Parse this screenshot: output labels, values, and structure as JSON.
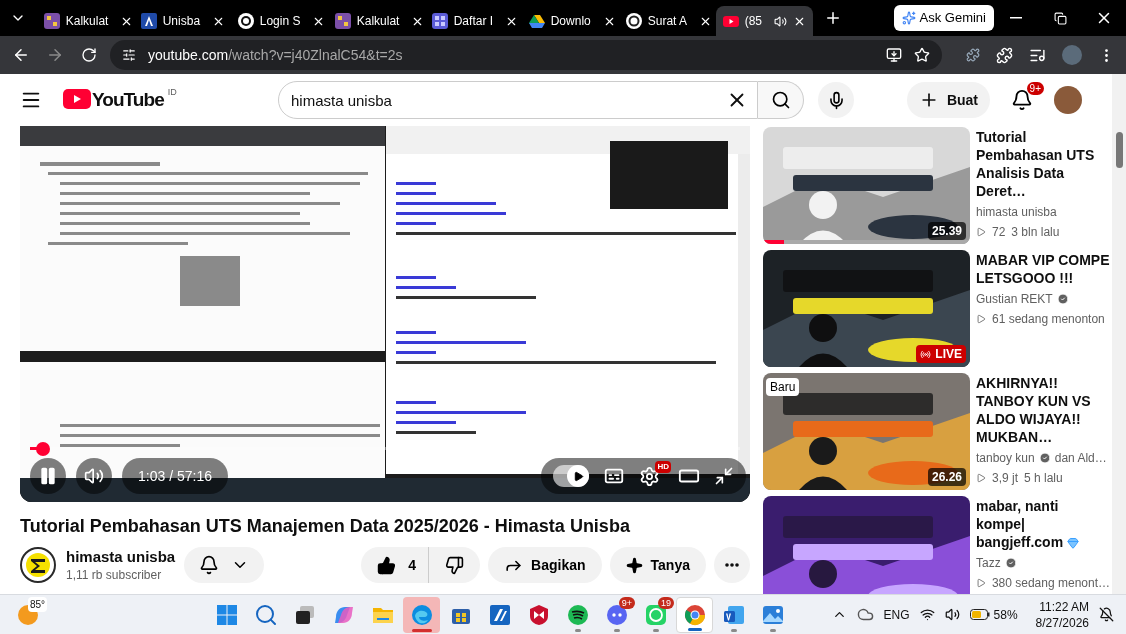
{
  "browser": {
    "tabs": [
      {
        "kind": "calculator",
        "title": "Kalkulat",
        "selected": false,
        "audio": false
      },
      {
        "kind": "letter",
        "title": "Unisba",
        "selected": false,
        "audio": false
      },
      {
        "kind": "ring",
        "title": "Login S",
        "selected": false,
        "audio": false
      },
      {
        "kind": "calculator",
        "title": "Kalkulat",
        "selected": false,
        "audio": false
      },
      {
        "kind": "grid",
        "title": "Daftar I",
        "selected": false,
        "audio": false
      },
      {
        "kind": "drive",
        "title": "Downlo",
        "selected": false,
        "audio": false
      },
      {
        "kind": "knot",
        "title": "Surat A",
        "selected": false,
        "audio": false
      },
      {
        "kind": "video",
        "title": "(85",
        "selected": true,
        "audio": true
      }
    ],
    "gemini_button": "Ask Gemini",
    "address": {
      "domain": "youtube.com",
      "path": "/watch?v=j40ZlnalC54&t=2s"
    }
  },
  "header": {
    "logo": "YouTube",
    "region": "ID",
    "search": {
      "value": "himasta unisba"
    },
    "create_button": "Buat",
    "notifications": "9+"
  },
  "player": {
    "progress": {
      "level": 0.018
    },
    "time": "1:03 / 57:16",
    "playing": true,
    "autoplay": true,
    "quality_badge": "HD"
  },
  "video": {
    "title": "Tutorial Pembahasan UTS Manajemen Data 2025/2026 - Himasta Unisba",
    "channel": "himasta unisba",
    "subscribers": "1,11 rb subscriber",
    "likes": "4",
    "share_button": "Bagikan",
    "ask_button": "Tanya"
  },
  "recommendations": [
    {
      "title": "Tutorial Pembahasan UTS Analisis Data Deret…",
      "channel": "himasta unisba",
      "verified": false,
      "stats": [
        "72",
        "3 bln lalu"
      ],
      "badges": [
        {
          "kind": "duration",
          "text": "25.39"
        }
      ],
      "watched": {
        "level": 0.1
      }
    },
    {
      "title": "MABAR VIP COMPE LETSGOOO !!!",
      "channel": "Gustian REKT",
      "verified": true,
      "stats": [
        "61 sedang menonton"
      ],
      "badges": [
        {
          "kind": "live",
          "text": "LIVE"
        }
      ]
    },
    {
      "title": "AKHIRNYA!! TANBOY KUN VS ALDO WIJAYA!! MUKBAN…",
      "channel": "tanboy kun",
      "verified": true,
      "channel_extra": "dan Ald…",
      "stats": [
        "3,9 jt",
        "5 h lalu"
      ],
      "badges": [
        {
          "kind": "new",
          "text": "Baru"
        },
        {
          "kind": "duration",
          "text": "26.26"
        }
      ]
    },
    {
      "title": "mabar, nanti kompe| bangjeff.com",
      "title_gem": true,
      "channel": "Tazz",
      "verified": true,
      "stats": [
        "380 sedang menont…"
      ]
    }
  ],
  "taskbar": {
    "weather": "85°",
    "apps": [
      {
        "kind": "start",
        "selected": false,
        "running": false,
        "attention": false
      },
      {
        "kind": "search",
        "selected": false,
        "running": false,
        "attention": false
      },
      {
        "kind": "taskview",
        "selected": false,
        "running": false,
        "attention": false
      },
      {
        "kind": "copilot",
        "selected": false,
        "running": false,
        "attention": false
      },
      {
        "kind": "folder",
        "selected": false,
        "running": false,
        "attention": false
      },
      {
        "kind": "edge",
        "selected": false,
        "running": true,
        "attention": true
      },
      {
        "kind": "store",
        "selected": false,
        "running": false,
        "attention": false
      },
      {
        "kind": "blueapp",
        "selected": false,
        "running": false,
        "attention": false
      },
      {
        "kind": "shield",
        "selected": false,
        "running": false,
        "attention": false
      },
      {
        "kind": "music",
        "selected": false,
        "running": true,
        "attention": false
      },
      {
        "kind": "chat",
        "selected": false,
        "running": true,
        "attention": false,
        "badge": "9+"
      },
      {
        "kind": "phone",
        "selected": false,
        "running": true,
        "attention": false,
        "badge": "19"
      },
      {
        "kind": "chrome",
        "selected": true,
        "running": true,
        "attention": false
      },
      {
        "kind": "word",
        "selected": false,
        "running": true,
        "attention": false
      },
      {
        "kind": "photos",
        "selected": false,
        "running": true,
        "attention": false
      }
    ],
    "language": "ENG",
    "battery": "58%",
    "time": "11:22 AM",
    "date": "8/27/2026"
  }
}
